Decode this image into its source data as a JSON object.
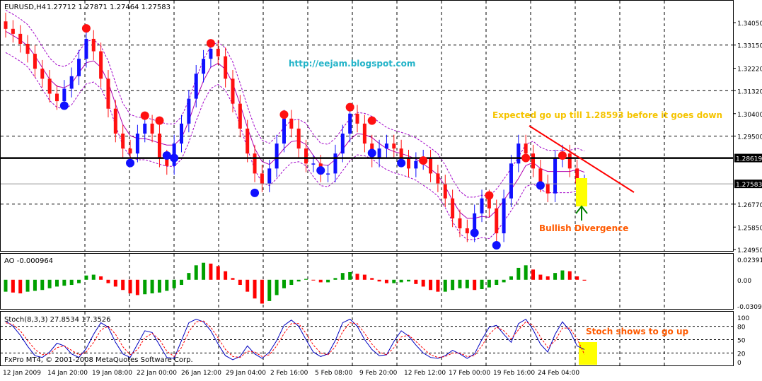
{
  "header": {
    "symbol": "EURUSD,H4",
    "ohlc": "1.27712 1.27871 1.27464 1.27583"
  },
  "annotations": {
    "url": "http://eejam.blogspot.com",
    "expected": "Expected go up till 1.28593 before it goes down",
    "bullish": "Bullish Divergence",
    "stoch": "Stoch shows to go up"
  },
  "footer": {
    "copyright": "FxPro MT4, © 2001-2008 MetaQuotes Software Corp."
  },
  "colors": {
    "bull": "#1010ff",
    "bear": "#ff1010",
    "envelope": "#a000c8",
    "ma": "#b000b0",
    "ao_up": "#00a000",
    "ao_down": "#ff0000",
    "stoch_main": "#0000c0",
    "stoch_signal": "#ff0000",
    "trend": "#ff0000",
    "highlight": "#ffff00"
  },
  "chart_data": [
    {
      "type": "candlestick",
      "name": "price",
      "price_ticks": [
        "1.34050",
        "1.33150",
        "1.32220",
        "1.31320",
        "1.30400",
        "1.29500",
        "1.28619",
        "1.27583",
        "1.26770",
        "1.25850",
        "1.24950"
      ],
      "tick_values": [
        1.3405,
        1.3315,
        1.3222,
        1.3132,
        1.304,
        1.295,
        1.28619,
        1.27583,
        1.2677,
        1.2585,
        1.2495
      ],
      "current_price": 1.27583,
      "resistance": 1.28619,
      "x_labels": [
        "12 Jan 2009",
        "14 Jan 20:00",
        "19 Jan 08:00",
        "22 Jan 00:00",
        "26 Jan 12:00",
        "29 Jan 04:00",
        "2 Feb 16:00",
        "5 Feb 08:00",
        "9 Feb 20:00",
        "12 Feb 12:00",
        "17 Feb 00:00",
        "19 Feb 16:00",
        "24 Feb 04:00"
      ],
      "closes": [
        1.338,
        1.336,
        1.332,
        1.328,
        1.322,
        1.318,
        1.312,
        1.309,
        1.314,
        1.319,
        1.326,
        1.334,
        1.329,
        1.318,
        1.306,
        1.296,
        1.29,
        1.288,
        1.296,
        1.3,
        1.296,
        1.286,
        1.283,
        1.292,
        1.3,
        1.31,
        1.32,
        1.326,
        1.33,
        1.327,
        1.318,
        1.308,
        1.298,
        1.288,
        1.28,
        1.276,
        1.282,
        1.292,
        1.302,
        1.298,
        1.29,
        1.284,
        1.284,
        1.28,
        1.28,
        1.288,
        1.296,
        1.304,
        1.3,
        1.292,
        1.286,
        1.29,
        1.292,
        1.29,
        1.286,
        1.282,
        1.285,
        1.286,
        1.28,
        1.276,
        1.27,
        1.262,
        1.258,
        1.256,
        1.264,
        1.27,
        1.266,
        1.256,
        1.27,
        1.284,
        1.292,
        1.288,
        1.282,
        1.276,
        1.272,
        1.286,
        1.288,
        1.282,
        1.276,
        1.276
      ],
      "fractals_up": [
        {
          "i": 11,
          "v": 1.3382
        },
        {
          "i": 19,
          "v": 1.3032
        },
        {
          "i": 21,
          "v": 1.3012
        },
        {
          "i": 28,
          "v": 1.3322
        },
        {
          "i": 38,
          "v": 1.3036
        },
        {
          "i": 47,
          "v": 1.3066
        },
        {
          "i": 50,
          "v": 1.3012
        },
        {
          "i": 57,
          "v": 1.2852
        },
        {
          "i": 66,
          "v": 1.2712
        },
        {
          "i": 71,
          "v": 1.2862
        },
        {
          "i": 76,
          "v": 1.2872
        }
      ],
      "fractals_down": [
        {
          "i": 8,
          "v": 1.3072
        },
        {
          "i": 17,
          "v": 1.2842
        },
        {
          "i": 22,
          "v": 1.2872
        },
        {
          "i": 23,
          "v": 1.2862
        },
        {
          "i": 34,
          "v": 1.2722
        },
        {
          "i": 43,
          "v": 1.2812
        },
        {
          "i": 50,
          "v": 1.2882
        },
        {
          "i": 54,
          "v": 1.2842
        },
        {
          "i": 64,
          "v": 1.2562
        },
        {
          "i": 67,
          "v": 1.2512
        },
        {
          "i": 73,
          "v": 1.2752
        }
      ]
    },
    {
      "type": "bar",
      "name": "AO -0.000964",
      "ticks": [
        "0.02391",
        "0.00",
        "-0.03091"
      ],
      "tick_values": [
        0.02391,
        0.0,
        -0.03091
      ],
      "values": [
        -0.014,
        -0.015,
        -0.016,
        -0.014,
        -0.013,
        -0.012,
        -0.01,
        -0.008,
        -0.007,
        -0.006,
        -0.004,
        0.005,
        0.006,
        0.004,
        -0.004,
        -0.008,
        -0.012,
        -0.016,
        -0.018,
        -0.017,
        -0.016,
        -0.015,
        -0.013,
        -0.01,
        -0.006,
        0.008,
        0.017,
        0.02,
        0.019,
        0.016,
        0.01,
        0.002,
        -0.006,
        -0.014,
        -0.022,
        -0.028,
        -0.025,
        -0.018,
        -0.01,
        -0.006,
        -0.002,
        0.001,
        0.0,
        -0.003,
        -0.003,
        0.002,
        0.008,
        0.009,
        0.007,
        0.006,
        0.002,
        -0.002,
        -0.004,
        -0.004,
        -0.003,
        -0.002,
        -0.005,
        -0.008,
        -0.012,
        -0.014,
        -0.014,
        -0.012,
        -0.01,
        -0.01,
        -0.012,
        -0.011,
        -0.009,
        -0.006,
        -0.003,
        0.004,
        0.014,
        0.017,
        0.012,
        0.006,
        0.004,
        0.008,
        0.011,
        0.01,
        0.004,
        -0.001
      ]
    },
    {
      "type": "line",
      "name": "Stoch(8,3,3) 27.8534 17.3526",
      "ticks": [
        "100",
        "80",
        "50",
        "20",
        "0"
      ],
      "tick_values": [
        100,
        80,
        50,
        20,
        0
      ],
      "levels": [
        80,
        50,
        20
      ],
      "series": [
        {
          "values": [
            92,
            80,
            60,
            35,
            14,
            10,
            22,
            42,
            36,
            18,
            10,
            30,
            62,
            88,
            78,
            44,
            18,
            10,
            40,
            70,
            66,
            38,
            10,
            8,
            48,
            88,
            96,
            90,
            70,
            40,
            14,
            5,
            12,
            36,
            18,
            8,
            22,
            48,
            82,
            94,
            80,
            50,
            22,
            12,
            18,
            48,
            88,
            96,
            80,
            50,
            28,
            14,
            16,
            46,
            70,
            58,
            38,
            20,
            10,
            8,
            14,
            26,
            18,
            8,
            18,
            50,
            78,
            82,
            62,
            44,
            86,
            96,
            72,
            40,
            22,
            62,
            90,
            70,
            36,
            28
          ]
        },
        {
          "values": [
            88,
            84,
            70,
            48,
            28,
            16,
            18,
            32,
            36,
            26,
            16,
            22,
            44,
            72,
            80,
            62,
            34,
            16,
            28,
            54,
            64,
            50,
            24,
            12,
            32,
            68,
            90,
            92,
            78,
            54,
            28,
            12,
            10,
            24,
            22,
            12,
            16,
            36,
            64,
            86,
            86,
            64,
            38,
            20,
            16,
            34,
            68,
            88,
            86,
            64,
            40,
            22,
            16,
            32,
            56,
            60,
            46,
            30,
            16,
            10,
            12,
            20,
            20,
            12,
            14,
            36,
            62,
            78,
            70,
            52,
            72,
            90,
            82,
            56,
            32,
            48,
            76,
            76,
            52,
            17
          ]
        }
      ]
    }
  ]
}
